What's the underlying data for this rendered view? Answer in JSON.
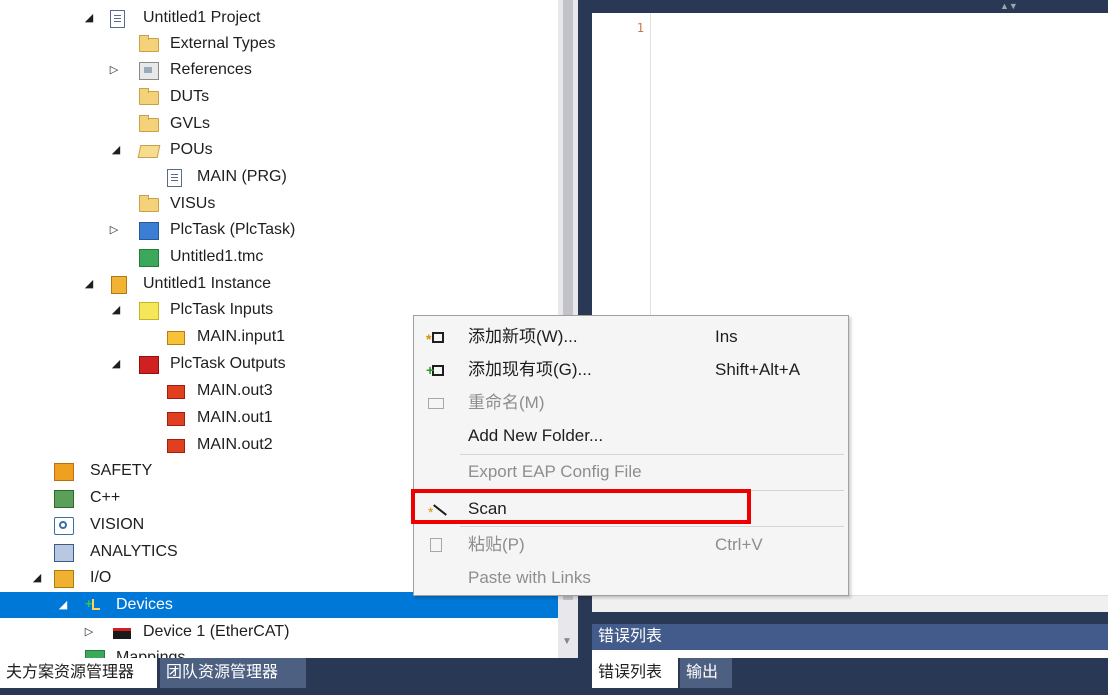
{
  "explorer": {
    "items": [
      {
        "label": "Untitled1 Project",
        "expanded": true,
        "icon": "project-icon"
      },
      {
        "label": "External Types",
        "icon": "folder-icon"
      },
      {
        "label": "References",
        "collapsed": true,
        "icon": "references-icon"
      },
      {
        "label": "DUTs",
        "icon": "folder-icon"
      },
      {
        "label": "GVLs",
        "icon": "folder-icon"
      },
      {
        "label": "POUs",
        "expanded": true,
        "icon": "folder-open-icon"
      },
      {
        "label": "MAIN (PRG)",
        "icon": "program-icon"
      },
      {
        "label": "VISUs",
        "icon": "folder-icon"
      },
      {
        "label": "PlcTask (PlcTask)",
        "collapsed": true,
        "icon": "task-icon"
      },
      {
        "label": "Untitled1.tmc",
        "icon": "tmc-icon"
      },
      {
        "label": "Untitled1 Instance",
        "expanded": true,
        "icon": "instance-icon"
      },
      {
        "label": "PlcTask Inputs",
        "expanded": true,
        "icon": "inputs-icon"
      },
      {
        "label": "MAIN.input1",
        "icon": "input-var-icon"
      },
      {
        "label": "PlcTask Outputs",
        "expanded": true,
        "icon": "outputs-icon"
      },
      {
        "label": "MAIN.out3",
        "icon": "output-var-icon"
      },
      {
        "label": "MAIN.out1",
        "icon": "output-var-icon"
      },
      {
        "label": "MAIN.out2",
        "icon": "output-var-icon"
      },
      {
        "label": "SAFETY",
        "icon": "safety-icon"
      },
      {
        "label": "C++",
        "icon": "cpp-icon"
      },
      {
        "label": "VISION",
        "icon": "vision-icon"
      },
      {
        "label": "ANALYTICS",
        "icon": "analytics-icon"
      },
      {
        "label": "I/O",
        "expanded": true,
        "icon": "io-icon"
      },
      {
        "label": "Devices",
        "expanded": true,
        "selected": true,
        "icon": "devices-icon"
      },
      {
        "label": "Device 1 (EtherCAT)",
        "collapsed": true,
        "icon": "ethercat-icon"
      },
      {
        "label": "Mappings",
        "icon": "mappings-icon"
      }
    ]
  },
  "editor": {
    "line_number": "1"
  },
  "error_panel": {
    "title": "错误列表"
  },
  "bottom_tabs": {
    "left": [
      "夫方案资源管理器",
      "团队资源管理器"
    ],
    "right": [
      "错误列表",
      "输出"
    ]
  },
  "context_menu": {
    "items": [
      {
        "label": "添加新项(W)...",
        "shortcut": "Ins",
        "icon": "add-new-item-icon",
        "enabled": true
      },
      {
        "label": "添加现有项(G)...",
        "shortcut": "Shift+Alt+A",
        "icon": "add-existing-item-icon",
        "enabled": true
      },
      {
        "label": "重命名(M)",
        "shortcut": "",
        "icon": "rename-icon",
        "enabled": false
      },
      {
        "label": "Add New Folder...",
        "shortcut": "",
        "icon": "",
        "enabled": true
      },
      {
        "label": "Export EAP Config File",
        "shortcut": "",
        "icon": "",
        "enabled": false
      },
      {
        "label": "Scan",
        "shortcut": "",
        "icon": "scan-wand-icon",
        "enabled": true,
        "highlighted": true
      },
      {
        "label": "粘贴(P)",
        "shortcut": "Ctrl+V",
        "icon": "paste-icon",
        "enabled": false
      },
      {
        "label": "Paste with Links",
        "shortcut": "",
        "icon": "",
        "enabled": false
      }
    ]
  },
  "colors": {
    "selection": "#0078d7",
    "chrome_dark": "#293955",
    "highlight_box": "#ee0000"
  }
}
